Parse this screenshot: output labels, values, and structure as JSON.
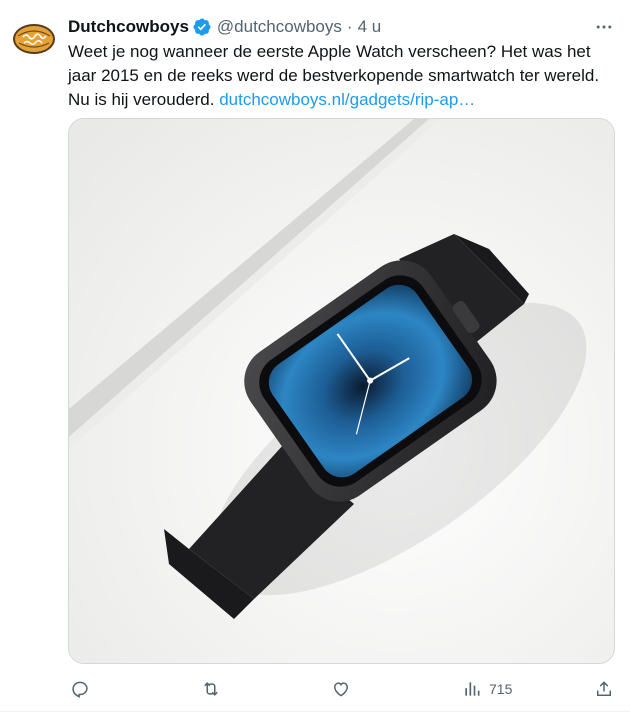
{
  "tweet": {
    "author": {
      "display_name": "Dutchcowboys",
      "handle": "@dutchcowboys",
      "avatar_text": "Dutch Cowboys",
      "verified_icon": "verified-badge-icon"
    },
    "separator": "·",
    "timestamp": "4 u",
    "text": "Weet je nog wanneer de eerste Apple Watch verscheen? Het was het jaar 2015 en de reeks werd de bestverkopende smartwatch ter wereld. Nu is hij verouderd.",
    "link_text": "dutchcowboys.nl/gadgets/rip-ap…"
  },
  "actions": {
    "reply_icon": "reply-icon",
    "retweet_icon": "retweet-icon",
    "like_icon": "heart-icon",
    "views_icon": "analytics-icon",
    "views_count": "715",
    "share_icon": "share-icon"
  },
  "colors": {
    "link": "#1d9bf0",
    "secondary_text": "#536471",
    "verified": "#1d9bf0"
  }
}
